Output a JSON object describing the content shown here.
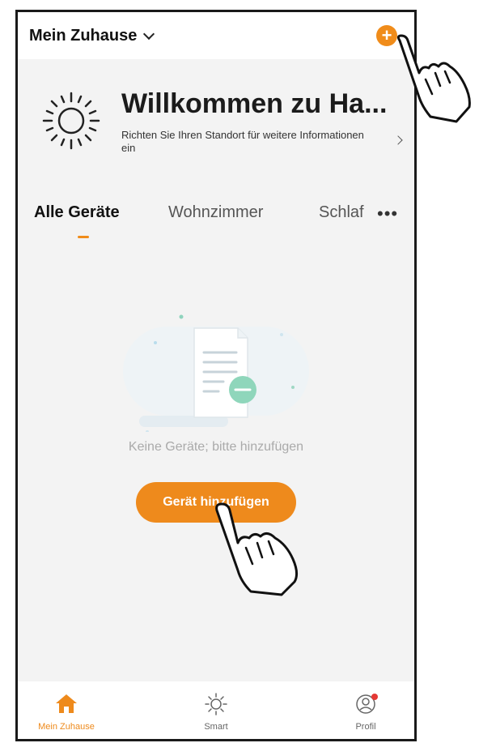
{
  "header": {
    "home_name": "Mein Zuhause",
    "home_chevron_icon": "chevron-down-icon",
    "add_icon": "plus-circle-icon",
    "add_symbol": "+"
  },
  "welcome": {
    "icon": "sun-icon",
    "title": "Willkommen zu Ha...",
    "subtitle": "Richten Sie Ihren Standort für weitere Informationen ein",
    "chevron_icon": "chevron-right-icon"
  },
  "tabs": {
    "items": [
      {
        "label": "Alle Geräte",
        "active": true
      },
      {
        "label": "Wohnzimmer",
        "active": false
      },
      {
        "label": "Schlaf",
        "active": false
      }
    ],
    "more_symbol": "•••"
  },
  "empty_state": {
    "illustration": "empty-document-illustration",
    "message": "Keine Geräte; bitte hinzufügen",
    "button_label": "Gerät hinzufügen"
  },
  "bottom_nav": {
    "items": [
      {
        "label": "Mein Zuhause",
        "icon": "home-icon",
        "active": true
      },
      {
        "label": "Smart",
        "icon": "sun-icon",
        "active": false
      },
      {
        "label": "Profil",
        "icon": "profile-icon",
        "active": false
      }
    ]
  },
  "colors": {
    "accent": "#f08c1a",
    "background": "#f3f3f3",
    "inactive_text": "#aaaaaa"
  },
  "overlays": {
    "pointer_icon": "hand-pointer-icon"
  }
}
